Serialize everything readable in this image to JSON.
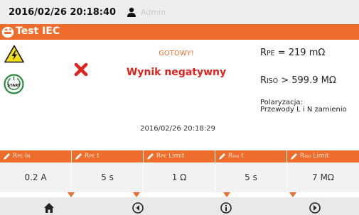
{
  "status_bar": {
    "datetime": "2016/02/26 20:18:40",
    "user": "Admin"
  },
  "title_bar": {
    "title": "Test IEC"
  },
  "main": {
    "status": "GOTOWY!",
    "result": "Wynik negatywny",
    "rpe": {
      "sym": "R",
      "sub": "PE",
      "value": " = 219 mΩ"
    },
    "riso": {
      "sym": "R",
      "sub": "ISO",
      "value": " > 599.9 MΩ"
    },
    "polarization_label": "Polaryzacja:",
    "polarization_value": "Przewody L i N zamienio",
    "timestamp": "2016/02/26 20:18:29"
  },
  "params": [
    {
      "sym": "R",
      "sub": "PE",
      "rest": " I",
      "sub2": "N",
      "value": "0.2 A"
    },
    {
      "sym": "R",
      "sub": "PE",
      "rest": " t",
      "sub2": "",
      "value": "5 s"
    },
    {
      "sym": "R",
      "sub": "PE",
      "rest": " Limit",
      "sub2": "",
      "value": "1 Ω"
    },
    {
      "sym": "R",
      "sub": "iso",
      "rest": " t",
      "sub2": "",
      "value": "5 s"
    },
    {
      "sym": "R",
      "sub": "iso",
      "rest": " Limit",
      "sub2": "",
      "value": "7 MΩ"
    }
  ],
  "nav": {
    "icons": [
      "home-icon",
      "arrow-left-icon",
      "info-icon",
      "arrow-right-icon"
    ]
  },
  "colors": {
    "accent": "#ee6d2c",
    "error": "#e5211b",
    "status_bar": "#eeeeee",
    "cell_bg": "#f2f2f2"
  }
}
